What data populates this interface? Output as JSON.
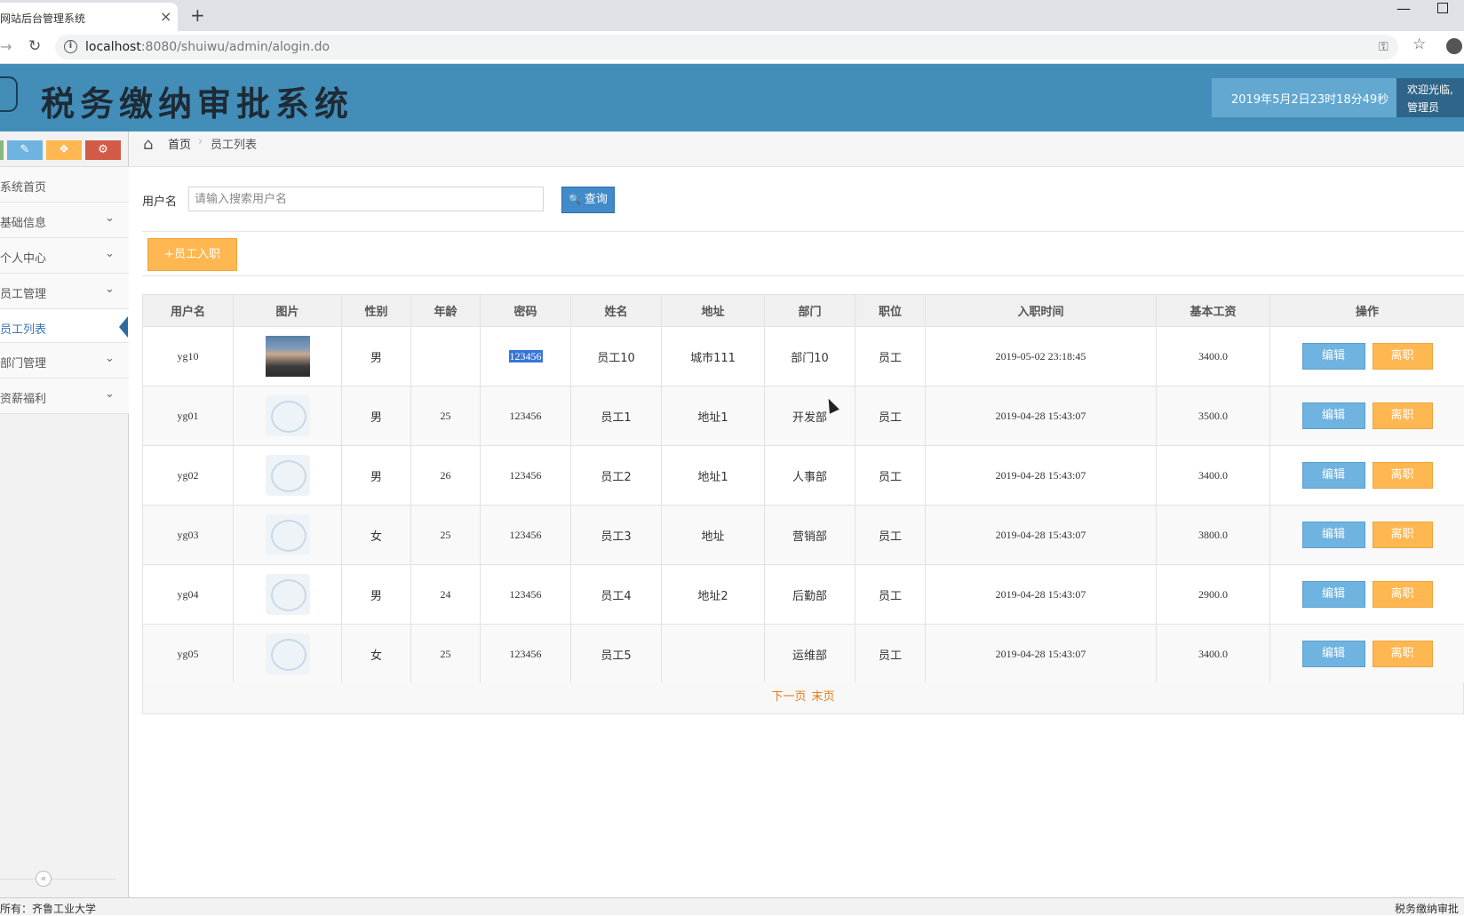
{
  "browser": {
    "tab_title": "网站后台管理系统",
    "tab_close": "×",
    "new_tab": "+",
    "url_host": "localhost",
    "url_rest": ":8080/shuiwu/admin/alogin.do"
  },
  "header": {
    "app_title": "税务缴纳审批系统",
    "datetime": "2019年5月2日23时18分49秒",
    "welcome": "欢迎光临,",
    "user_role": "管理员"
  },
  "sidebar": {
    "shortcuts": [
      "✎",
      "❖",
      "⚙"
    ],
    "items": [
      {
        "label": "系统首页",
        "has_chevron": false
      },
      {
        "label": "基础信息",
        "has_chevron": true
      },
      {
        "label": "个人中心",
        "has_chevron": true
      },
      {
        "label": "员工管理",
        "has_chevron": true
      },
      {
        "label": "员工列表",
        "has_chevron": false
      },
      {
        "label": "部门管理",
        "has_chevron": true
      },
      {
        "label": "资薪福利",
        "has_chevron": true
      }
    ],
    "chevron": "⌄",
    "collapse": "«"
  },
  "breadcrumb": {
    "home": "首页",
    "separator": "›",
    "current": "员工列表"
  },
  "search": {
    "label": "用户名",
    "placeholder": "请输入搜索用户名",
    "button": "查询",
    "button_icon": "🔍"
  },
  "add_button": "+员工入职",
  "table": {
    "headers": [
      "用户名",
      "图片",
      "性别",
      "年龄",
      "密码",
      "姓名",
      "地址",
      "部门",
      "职位",
      "入职时间",
      "基本工资",
      "操作"
    ],
    "rows": [
      {
        "username": "yg10",
        "photo": "real",
        "gender": "男",
        "age": "",
        "password": "123456",
        "name": "员工10",
        "address": "城市111",
        "dept": "部门10",
        "position": "员工",
        "hired": "2019-05-02 23:18:45",
        "salary": "3400.0"
      },
      {
        "username": "yg01",
        "photo": "placeholder",
        "gender": "男",
        "age": "25",
        "password": "123456",
        "name": "员工1",
        "address": "地址1",
        "dept": "开发部",
        "position": "员工",
        "hired": "2019-04-28 15:43:07",
        "salary": "3500.0"
      },
      {
        "username": "yg02",
        "photo": "placeholder",
        "gender": "男",
        "age": "26",
        "password": "123456",
        "name": "员工2",
        "address": "地址1",
        "dept": "人事部",
        "position": "员工",
        "hired": "2019-04-28 15:43:07",
        "salary": "3400.0"
      },
      {
        "username": "yg03",
        "photo": "placeholder",
        "gender": "女",
        "age": "25",
        "password": "123456",
        "name": "员工3",
        "address": "地址",
        "dept": "营销部",
        "position": "员工",
        "hired": "2019-04-28 15:43:07",
        "salary": "3800.0"
      },
      {
        "username": "yg04",
        "photo": "placeholder",
        "gender": "男",
        "age": "24",
        "password": "123456",
        "name": "员工4",
        "address": "地址2",
        "dept": "后勤部",
        "position": "员工",
        "hired": "2019-04-28 15:43:07",
        "salary": "2900.0"
      },
      {
        "username": "yg05",
        "photo": "placeholder",
        "gender": "女",
        "age": "25",
        "password": "123456",
        "name": "员工5",
        "address": "",
        "dept": "运维部",
        "position": "员工",
        "hired": "2019-04-28 15:43:07",
        "salary": "3400.0"
      }
    ],
    "edit_label": "编辑",
    "leave_label": "离职"
  },
  "pager": {
    "next": "下一页",
    "last": "末页"
  },
  "status": {
    "left": "所有：齐鲁工业大学",
    "right": "税务缴纳审批"
  }
}
